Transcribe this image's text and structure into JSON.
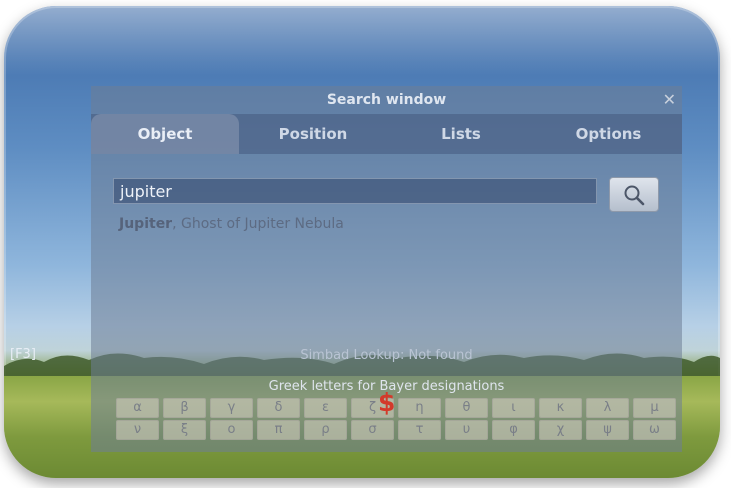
{
  "side_label": "[F3]",
  "window": {
    "title": "Search window",
    "close_symbol": "✕",
    "tabs": [
      {
        "label": "Object",
        "active": true
      },
      {
        "label": "Position",
        "active": false
      },
      {
        "label": "Lists",
        "active": false
      },
      {
        "label": "Options",
        "active": false
      }
    ],
    "search": {
      "value": "jupiter",
      "button_icon": "magnifier-icon"
    },
    "result": {
      "primary": "Jupiter",
      "rest": ", Ghost of Jupiter Nebula"
    },
    "simbad_status": "Simbad Lookup: Not found",
    "greek": {
      "title": "Greek letters for Bayer designations",
      "row1": [
        "α",
        "β",
        "γ",
        "δ",
        "ε",
        "ζ",
        "η",
        "θ",
        "ι",
        "κ",
        "λ",
        "μ"
      ],
      "row2": [
        "ν",
        "ξ",
        "ο",
        "π",
        "ρ",
        "σ",
        "τ",
        "υ",
        "φ",
        "χ",
        "ψ",
        "ω"
      ]
    },
    "overlay_symbol": "$"
  }
}
